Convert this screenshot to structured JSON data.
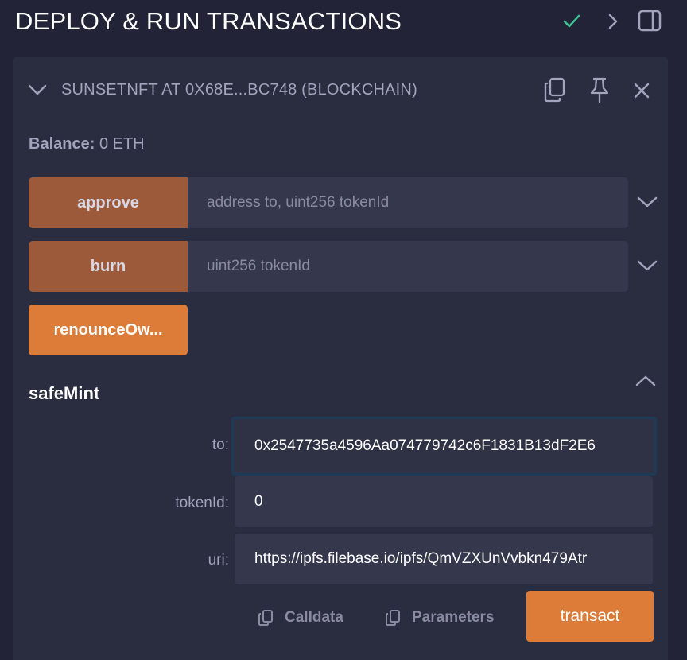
{
  "header": {
    "title": "DEPLOY & RUN TRANSACTIONS"
  },
  "instance": {
    "title": "SUNSETNFT AT 0X68E...BC748 (BLOCKCHAIN)",
    "balance_label": "Balance:",
    "balance_value": "0 ETH"
  },
  "functions": [
    {
      "label": "approve",
      "placeholder": "address to, uint256 tokenId"
    },
    {
      "label": "burn",
      "placeholder": "uint256 tokenId"
    },
    {
      "label": "renounceOw..."
    }
  ],
  "safeMint": {
    "title": "safeMint",
    "params": [
      {
        "label": "to:",
        "value": "0x2547735a4596Aa074779742c6F1831B13dF2E6"
      },
      {
        "label": "tokenId:",
        "value": "0"
      },
      {
        "label": "uri:",
        "value": "https://ipfs.filebase.io/ipfs/QmVZXUnVvbkn479Atr"
      }
    ],
    "calldata_label": "Calldata",
    "parameters_label": "Parameters",
    "transact_label": "transact"
  },
  "colors": {
    "background": "#222336",
    "panel": "#2a2c3f",
    "accent_orange": "#dc7c38",
    "muted_orange": "#9c5a3a",
    "check_green": "#3ec28f"
  }
}
